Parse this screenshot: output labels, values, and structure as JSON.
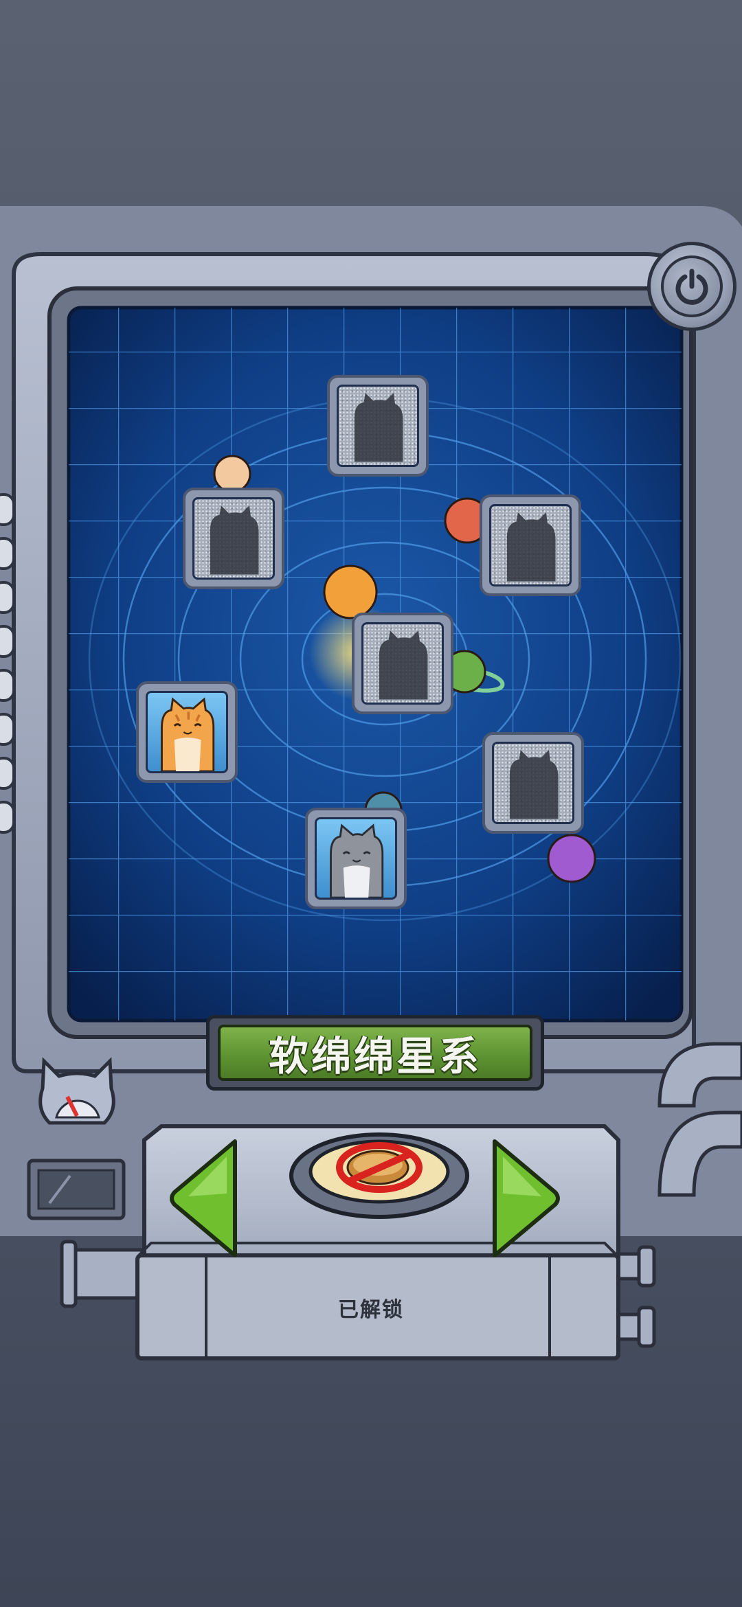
{
  "galaxy": {
    "name": "软绵绵星系"
  },
  "status": {
    "label": "已解锁"
  },
  "controls": {
    "power": "power-icon",
    "prev": "arrow-left-icon",
    "next": "arrow-right-icon",
    "center": "no-pancake-icon"
  },
  "cats": [
    {
      "id": "cat-1",
      "state": "locked"
    },
    {
      "id": "cat-2",
      "state": "locked"
    },
    {
      "id": "cat-3",
      "state": "locked"
    },
    {
      "id": "cat-4",
      "state": "locked"
    },
    {
      "id": "cat-5",
      "state": "unlocked",
      "color": "orange"
    },
    {
      "id": "cat-6",
      "state": "locked"
    },
    {
      "id": "cat-7",
      "state": "unlocked",
      "color": "gray"
    }
  ],
  "colors": {
    "screen": "#0d3a7a",
    "grid": "#3f86d4",
    "panel": "#a9b2c6",
    "title_green": "#5e9432",
    "arrow_green": "#6fbf2e"
  }
}
